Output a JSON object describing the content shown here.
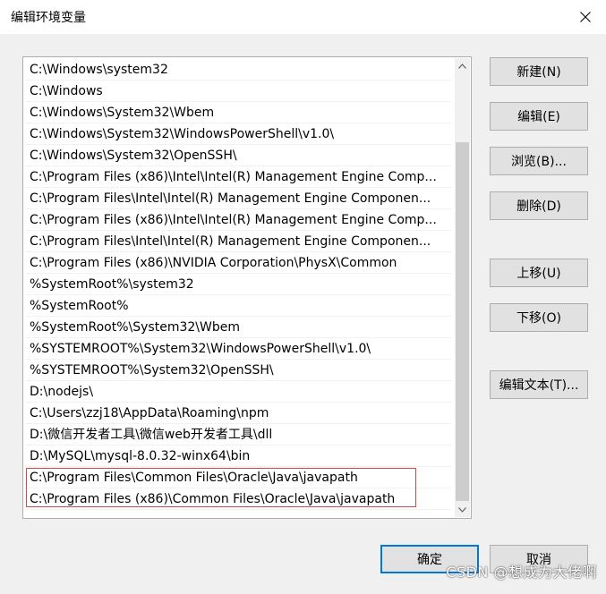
{
  "window": {
    "title": "编辑环境变量"
  },
  "paths": [
    "C:\\Windows\\system32",
    "C:\\Windows",
    "C:\\Windows\\System32\\Wbem",
    "C:\\Windows\\System32\\WindowsPowerShell\\v1.0\\",
    "C:\\Windows\\System32\\OpenSSH\\",
    "C:\\Program Files (x86)\\Intel\\Intel(R) Management Engine Comp...",
    "C:\\Program Files\\Intel\\Intel(R) Management Engine Componen...",
    "C:\\Program Files (x86)\\Intel\\Intel(R) Management Engine Comp...",
    "C:\\Program Files\\Intel\\Intel(R) Management Engine Componen...",
    "C:\\Program Files (x86)\\NVIDIA Corporation\\PhysX\\Common",
    "%SystemRoot%\\system32",
    "%SystemRoot%",
    "%SystemRoot%\\System32\\Wbem",
    "%SYSTEMROOT%\\System32\\WindowsPowerShell\\v1.0\\",
    "%SYSTEMROOT%\\System32\\OpenSSH\\",
    "D:\\nodejs\\",
    "C:\\Users\\zzj18\\AppData\\Roaming\\npm",
    "D:\\微信开发者工具\\微信web开发者工具\\dll",
    "D:\\MySQL\\mysql-8.0.32-winx64\\bin",
    "C:\\Program Files\\Common Files\\Oracle\\Java\\javapath",
    "C:\\Program Files (x86)\\Common Files\\Oracle\\Java\\javapath"
  ],
  "buttons": {
    "new": "新建(N)",
    "edit": "编辑(E)",
    "browse": "浏览(B)...",
    "delete": "删除(D)",
    "move_up": "上移(U)",
    "move_down": "下移(O)",
    "edit_text": "编辑文本(T)...",
    "ok": "确定",
    "cancel": "取消"
  },
  "watermark": "CSDN @想成为大佬啊",
  "colors": {
    "highlight_border": "#c84b4b",
    "ok_border": "#0078d7"
  }
}
